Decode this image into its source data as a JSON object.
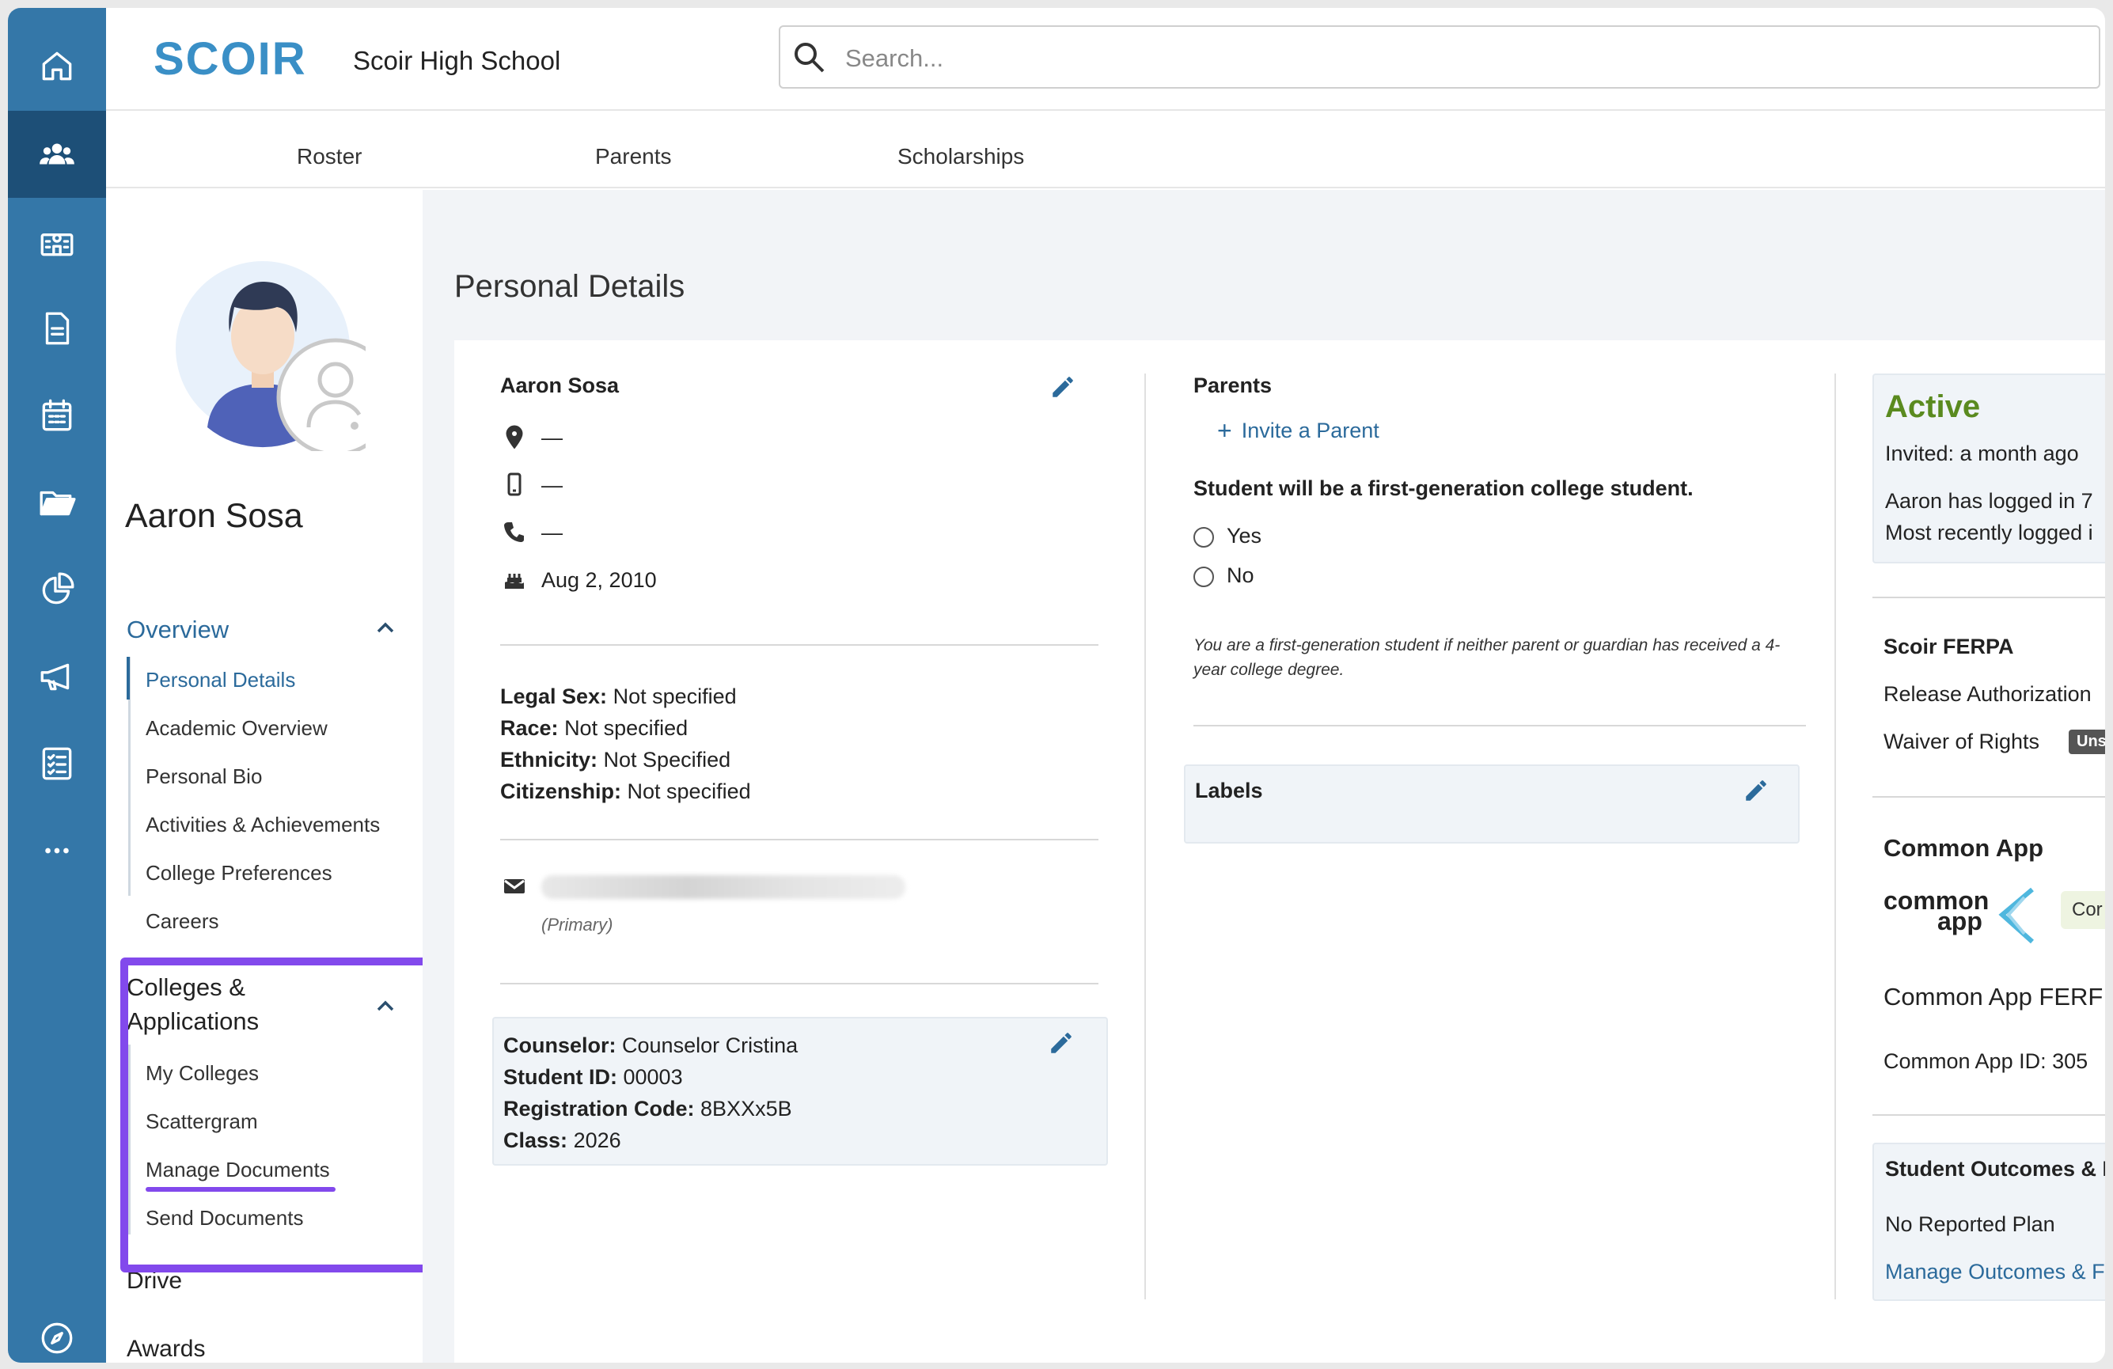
{
  "app": {
    "logo_text": "SCOIR",
    "school_name": "Scoir High School"
  },
  "search": {
    "placeholder": "Search..."
  },
  "tabs": [
    "Roster",
    "Parents",
    "Scholarships"
  ],
  "rail_icons": [
    "home-icon",
    "students-icon",
    "school-icon",
    "document-icon",
    "calendar-icon",
    "folder-icon",
    "analytics-icon",
    "megaphone-icon",
    "checklist-icon",
    "more-icon",
    "compass-icon"
  ],
  "student": {
    "name": "Aaron Sosa"
  },
  "sidenav": {
    "overview_label": "Overview",
    "overview_items": [
      "Personal Details",
      "Academic Overview",
      "Personal Bio",
      "Activities & Achievements",
      "College Preferences",
      "Careers"
    ],
    "colleges_label_line1": "Colleges &",
    "colleges_label_line2": "Applications",
    "colleges_items": [
      "My Colleges",
      "Scattergram",
      "Manage Documents",
      "Send Documents"
    ],
    "drive_label": "Drive",
    "awards_label": "Awards"
  },
  "main": {
    "title": "Personal Details",
    "profile": {
      "name": "Aaron Sosa",
      "location": "—",
      "mobile": "—",
      "phone": "—",
      "birthday": "Aug 2, 2010"
    },
    "demographics": [
      {
        "label": "Legal Sex:",
        "value": "Not specified"
      },
      {
        "label": "Race:",
        "value": "Not specified"
      },
      {
        "label": "Ethnicity:",
        "value": "Not Specified"
      },
      {
        "label": "Citizenship:",
        "value": "Not specified"
      }
    ],
    "email": {
      "note": "(Primary)"
    },
    "counselor_info": [
      {
        "label": "Counselor:",
        "value": "Counselor Cristina"
      },
      {
        "label": "Student ID:",
        "value": "00003"
      },
      {
        "label": "Registration Code:",
        "value": "8BXXx5B"
      },
      {
        "label": "Class:",
        "value": "2026"
      }
    ],
    "parents": {
      "heading": "Parents",
      "invite_label": "Invite a Parent",
      "first_gen_question": "Student will be a first-generation college student.",
      "options": [
        "Yes",
        "No"
      ],
      "note": "You are a first-generation student if neither parent or guardian has received a 4-year college degree."
    },
    "labels": {
      "heading": "Labels"
    },
    "status": {
      "state": "Active",
      "invited": "Invited: a month ago",
      "logins_line": "Aaron has logged in 7",
      "recent_line": "Most recently logged i"
    },
    "ferpa": {
      "heading": "Scoir FERPA",
      "release": "Release Authorization",
      "waiver": "Waiver of Rights",
      "waiver_badge": "Unsi"
    },
    "common_app": {
      "heading": "Common App",
      "logo_line1": "common",
      "logo_line2": "app",
      "tag": "Cor",
      "ferpa": "Common App FERF",
      "id_line": "Common App ID:  305"
    },
    "outcomes": {
      "heading": "Student Outcomes & F",
      "plan": "No Reported Plan",
      "link": "Manage Outcomes & F"
    }
  },
  "colors": {
    "rail": "#3477a8",
    "rail_active": "#1d4f77",
    "accent": "#2b6a9b",
    "highlight": "#8249ec",
    "active_green": "#5a8a1f"
  }
}
